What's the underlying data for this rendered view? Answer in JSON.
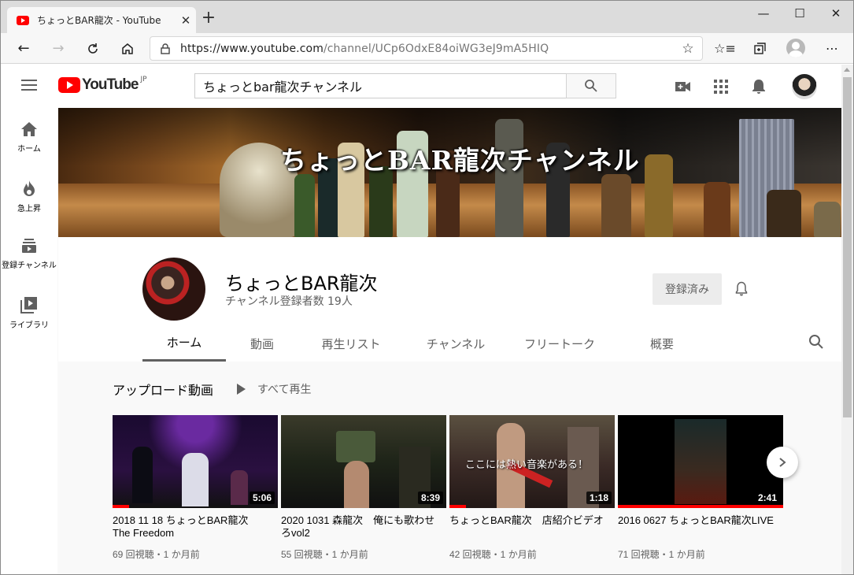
{
  "browser": {
    "tab_title": "ちょっとBAR龍次 - YouTube",
    "url_host": "https://www.youtube.com",
    "url_path": "/channel/UCp6OdxE84oiWG3eJ9mA5HIQ"
  },
  "masthead": {
    "logo_text": "YouTube",
    "logo_region": "JP",
    "search_value": "ちょっとbar龍次チャンネル"
  },
  "guide": {
    "items": [
      {
        "label": "ホーム",
        "icon": "home-icon"
      },
      {
        "label": "急上昇",
        "icon": "fire-icon"
      },
      {
        "label": "登録チャンネル",
        "icon": "subscriptions-icon"
      },
      {
        "label": "ライブラリ",
        "icon": "library-icon"
      }
    ]
  },
  "banner": {
    "title": "ちょっとBAR龍次チャンネル"
  },
  "channel": {
    "name": "ちょっとBAR龍次",
    "subscribers": "チャンネル登録者数 19人",
    "subscribe_label": "登録済み",
    "tabs": [
      {
        "label": "ホーム",
        "active": true
      },
      {
        "label": "動画",
        "active": false
      },
      {
        "label": "再生リスト",
        "active": false
      },
      {
        "label": "チャンネル",
        "active": false
      },
      {
        "label": "フリートーク",
        "active": false
      },
      {
        "label": "概要",
        "active": false
      }
    ]
  },
  "shelf": {
    "title": "アップロード動画",
    "play_all": "すべて再生",
    "videos": [
      {
        "title": "2018 11 18 ちょっとBAR龍次　The Freedom",
        "duration": "5:06",
        "meta": "69 回視聴・1 か月前",
        "watched": 0.1
      },
      {
        "title": "2020 1031 森龍次　俺にも歌わせろvol2",
        "duration": "8:39",
        "meta": "55 回視聴・1 か月前",
        "watched": 0.0
      },
      {
        "title": "ちょっとBAR龍次　店紹介ビデオ",
        "duration": "1:18",
        "meta": "42 回視聴・1 か月前",
        "watched": 0.1,
        "overlay": "ここには熱い音楽がある！"
      },
      {
        "title": "2016 0627 ちょっとBAR龍次LIVE",
        "duration": "2:41",
        "meta": "71 回視聴・1 か月前",
        "watched": 1.0
      }
    ]
  },
  "colors": {
    "brand_red": "#ff0000",
    "text_secondary": "#606060"
  }
}
